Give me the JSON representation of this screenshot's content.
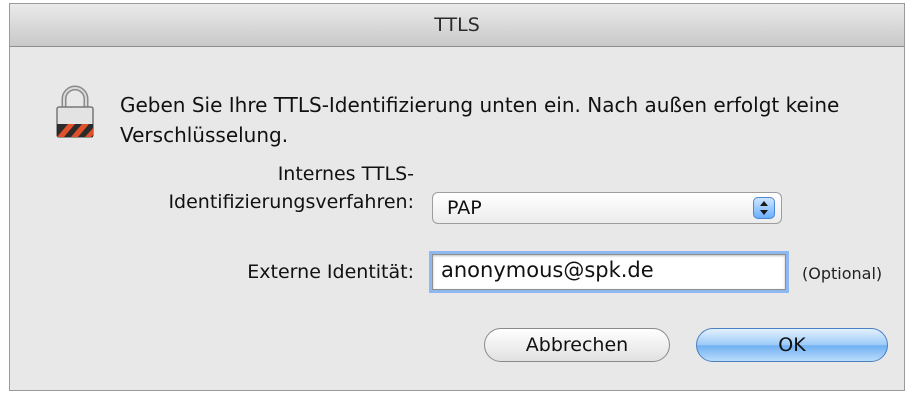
{
  "window": {
    "title": "TTLS"
  },
  "message": "Geben Sie Ihre TTLS-Identifizierung unten ein. Nach außen erfolgt keine Verschlüsselung.",
  "method": {
    "label_line1": "Internes TTLS-",
    "label_line2": "Identifizierungsverfahren:",
    "selected": "PAP"
  },
  "identity": {
    "label": "Externe Identität:",
    "value": "anonymous@spk.de",
    "optional_note": "(Optional)"
  },
  "buttons": {
    "cancel": "Abbrechen",
    "ok": "OK"
  },
  "colors": {
    "default_button": "#6fb0f2",
    "focus_ring": "#8db8f0"
  }
}
